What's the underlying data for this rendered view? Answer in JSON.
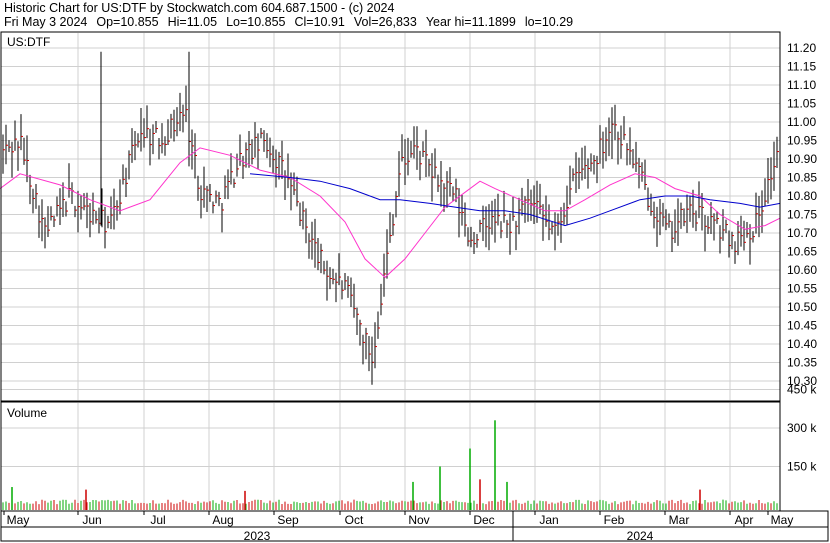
{
  "header": {
    "line1": "Historic Chart for US:DTF by Stockwatch.com 604.687.1500 - (c) 2024",
    "date": "Fri May  3 2024",
    "op": "Op=10.855",
    "hi": "Hi=11.05",
    "lo": "Lo=10.855",
    "cl": "Cl=10.91",
    "vol": "Vol=26,833",
    "yearhi": "Year hi=11.1899",
    "yearlo": "lo=10.29"
  },
  "chart_data": {
    "type": "ohlc",
    "price_panel": {
      "symbol": "US:DTF",
      "ylim": [
        10.25,
        11.24
      ],
      "yticks": [
        "11.20",
        "11.15",
        "11.10",
        "11.05",
        "11.00",
        "10.95",
        "10.90",
        "10.85",
        "10.80",
        "10.75",
        "10.70",
        "10.65",
        "10.60",
        "10.55",
        "10.50",
        "10.45",
        "10.40",
        "10.35",
        "10.30"
      ],
      "grid": true,
      "bar_color": "#000000",
      "close_tick_color": "#cc0000",
      "series": [
        {
          "type": "moving_average",
          "color": "#ff33cc",
          "points": [
            [
              0,
              10.82
            ],
            [
              20,
              10.86
            ],
            [
              60,
              10.83
            ],
            [
              90,
              10.79
            ],
            [
              120,
              10.76
            ],
            [
              150,
              10.79
            ],
            [
              180,
              10.89
            ],
            [
              200,
              10.93
            ],
            [
              230,
              10.91
            ],
            [
              260,
              10.87
            ],
            [
              290,
              10.85
            ],
            [
              320,
              10.8
            ],
            [
              345,
              10.73
            ],
            [
              365,
              10.63
            ],
            [
              385,
              10.58
            ],
            [
              405,
              10.63
            ],
            [
              425,
              10.7
            ],
            [
              445,
              10.77
            ],
            [
              465,
              10.81
            ],
            [
              480,
              10.84
            ],
            [
              495,
              10.82
            ],
            [
              520,
              10.79
            ],
            [
              545,
              10.76
            ],
            [
              565,
              10.76
            ],
            [
              585,
              10.79
            ],
            [
              610,
              10.83
            ],
            [
              635,
              10.86
            ],
            [
              655,
              10.85
            ],
            [
              675,
              10.82
            ],
            [
              700,
              10.8
            ],
            [
              720,
              10.75
            ],
            [
              745,
              10.71
            ],
            [
              765,
              10.72
            ],
            [
              780,
              10.74
            ]
          ]
        },
        {
          "type": "moving_average",
          "color": "#0000cc",
          "points": [
            [
              250,
              10.86
            ],
            [
              290,
              10.85
            ],
            [
              320,
              10.84
            ],
            [
              350,
              10.82
            ],
            [
              380,
              10.79
            ],
            [
              400,
              10.79
            ],
            [
              430,
              10.78
            ],
            [
              455,
              10.77
            ],
            [
              480,
              10.76
            ],
            [
              505,
              10.76
            ],
            [
              530,
              10.75
            ],
            [
              565,
              10.72
            ],
            [
              590,
              10.74
            ],
            [
              610,
              10.76
            ],
            [
              640,
              10.79
            ],
            [
              665,
              10.8
            ],
            [
              690,
              10.8
            ],
            [
              710,
              10.79
            ],
            [
              740,
              10.78
            ],
            [
              760,
              10.77
            ],
            [
              780,
              10.78
            ]
          ]
        }
      ]
    },
    "volume_panel": {
      "label": "Volume",
      "yticks": [
        "450 k",
        "300 k",
        "150 k"
      ],
      "ylim": [
        0,
        560
      ],
      "units": "k shares",
      "up_color": "#00aa00",
      "down_color": "#cc0000",
      "spikes": [
        {
          "x": 12,
          "value": 70,
          "color": "green"
        },
        {
          "x": 86,
          "value": 60,
          "color": "red"
        },
        {
          "x": 245,
          "value": 55,
          "color": "red"
        },
        {
          "x": 413,
          "value": 90,
          "color": "green"
        },
        {
          "x": 440,
          "value": 150,
          "color": "green"
        },
        {
          "x": 470,
          "value": 220,
          "color": "green"
        },
        {
          "x": 480,
          "value": 100,
          "color": "red"
        },
        {
          "x": 495,
          "value": 330,
          "color": "green"
        },
        {
          "x": 507,
          "value": 90,
          "color": "green"
        },
        {
          "x": 700,
          "value": 60,
          "color": "red"
        }
      ]
    },
    "x_axis": {
      "months": [
        "May",
        "Jun",
        "Jul",
        "Aug",
        "Sep",
        "Oct",
        "Nov",
        "Dec",
        "Jan",
        "Feb",
        "Mar",
        "Apr",
        "May"
      ],
      "years": [
        "2023",
        "2024"
      ]
    }
  }
}
